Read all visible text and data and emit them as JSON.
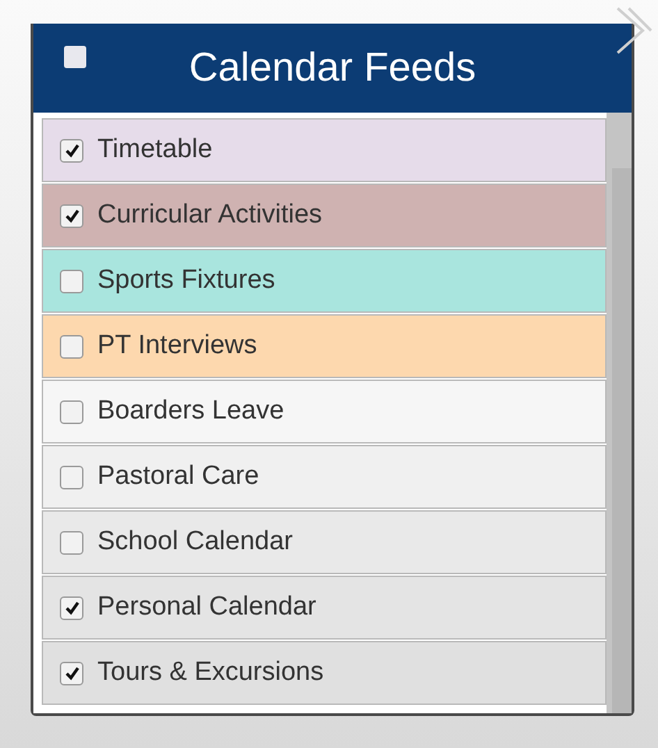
{
  "panel": {
    "title": "Calendar Feeds",
    "select_all": {
      "checked": false
    }
  },
  "feeds": [
    {
      "label": "Timetable",
      "checked": true,
      "color": "#e6dcea"
    },
    {
      "label": "Curricular Activities",
      "checked": true,
      "color": "#cfb2b1"
    },
    {
      "label": "Sports Fixtures",
      "checked": false,
      "color": "#a9e5de"
    },
    {
      "label": "PT Interviews",
      "checked": false,
      "color": "#fdd8ae"
    },
    {
      "label": "Boarders Leave",
      "checked": false,
      "color": "#f6f6f6"
    },
    {
      "label": "Pastoral Care",
      "checked": false,
      "color": "#f0f0f0"
    },
    {
      "label": "School Calendar",
      "checked": false,
      "color": "#e9e9e9"
    },
    {
      "label": "Personal Calendar",
      "checked": true,
      "color": "#e4e4e4"
    },
    {
      "label": "Tours & Excursions",
      "checked": true,
      "color": "#e0e0e0"
    }
  ]
}
